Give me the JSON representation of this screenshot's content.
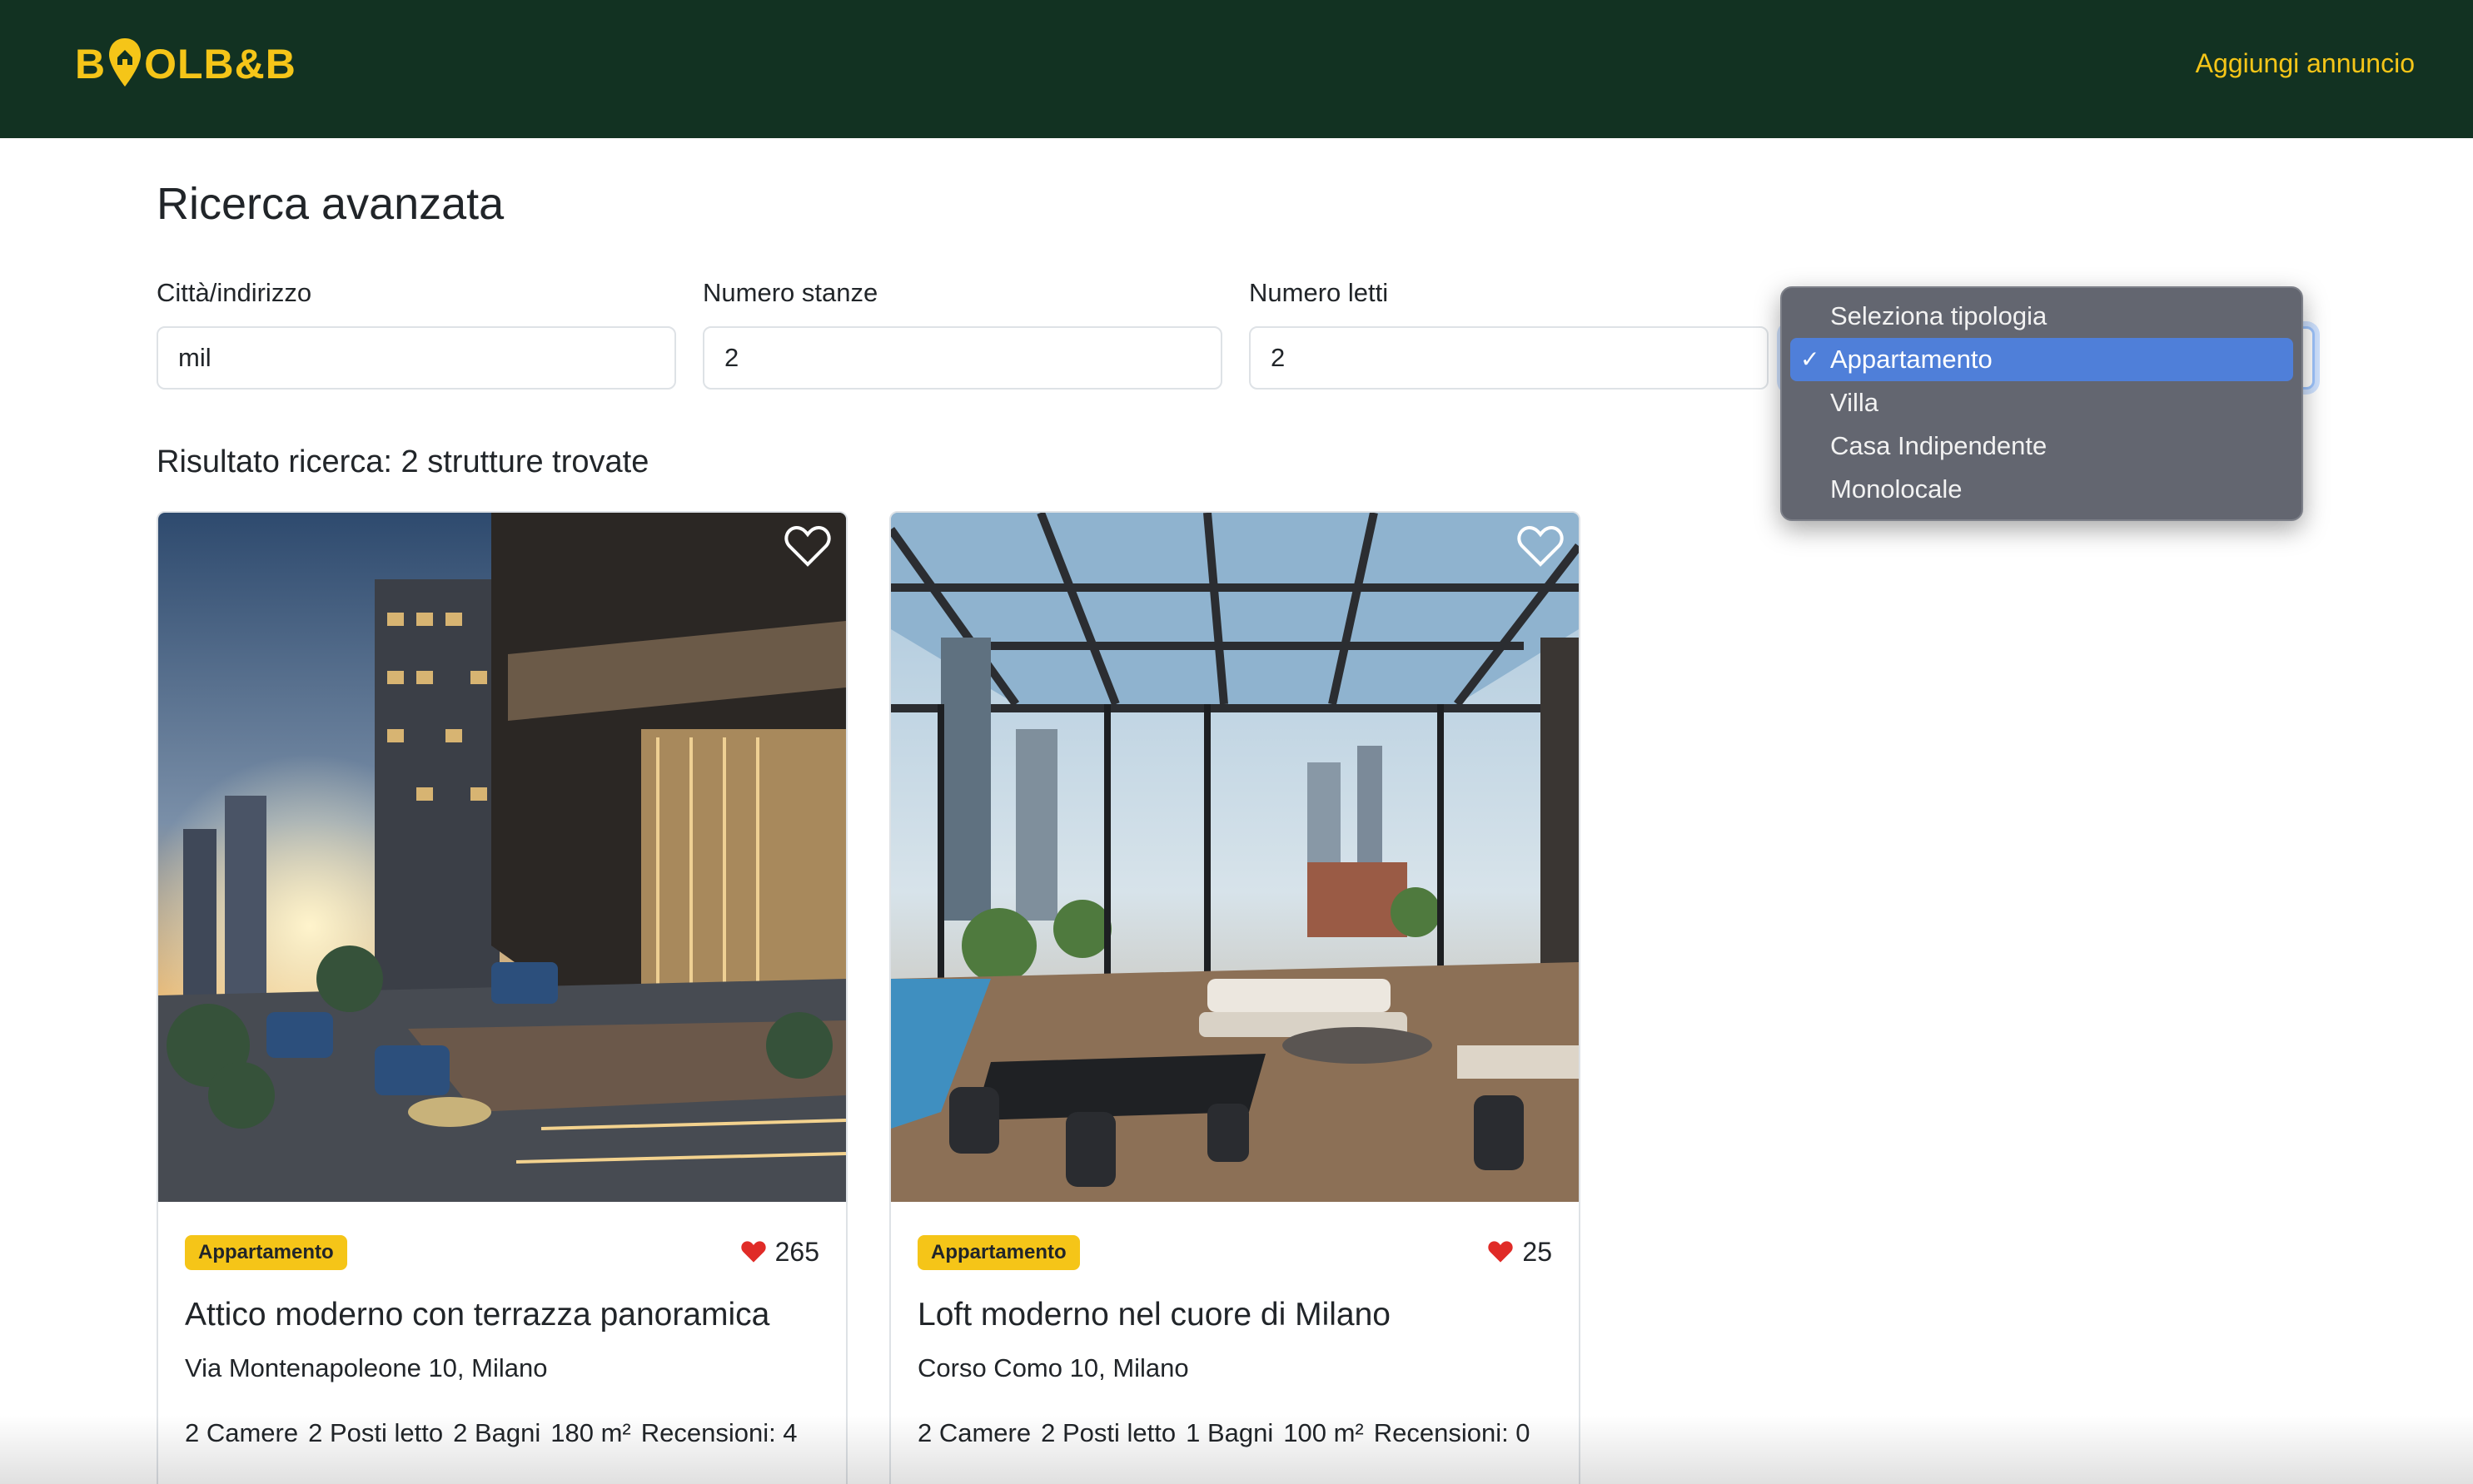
{
  "brand": {
    "logo_left": "B",
    "logo_right": "OLB&B",
    "accent_color": "#f5c518",
    "navbar_color": "#123222"
  },
  "nav": {
    "add_listing": "Aggiungi annuncio"
  },
  "page": {
    "title": "Ricerca avanzata"
  },
  "filters": {
    "city": {
      "label": "Città/indirizzo",
      "value": "mil"
    },
    "rooms": {
      "label": "Numero stanze",
      "value": "2"
    },
    "beds": {
      "label": "Numero letti",
      "value": "2"
    },
    "type": {
      "selected": "Appartamento",
      "options": [
        "Seleziona tipologia",
        "Appartamento",
        "Villa",
        "Casa Indipendente",
        "Monolocale"
      ]
    }
  },
  "results": {
    "summary": "Risultato ricerca: 2 strutture trovate",
    "cards": [
      {
        "badge": "Appartamento",
        "likes": "265",
        "title": "Attico moderno con terrazza panoramica",
        "address": "Via Montenapoleone 10, Milano",
        "stats": [
          "2 Camere",
          "2 Posti letto",
          "2 Bagni",
          "180 m²",
          "Recensioni: 4"
        ]
      },
      {
        "badge": "Appartamento",
        "likes": "25",
        "title": "Loft moderno nel cuore di Milano",
        "address": "Corso Como 10, Milano",
        "stats": [
          "2 Camere",
          "2 Posti letto",
          "1 Bagni",
          "100 m²",
          "Recensioni: 0"
        ]
      }
    ]
  }
}
